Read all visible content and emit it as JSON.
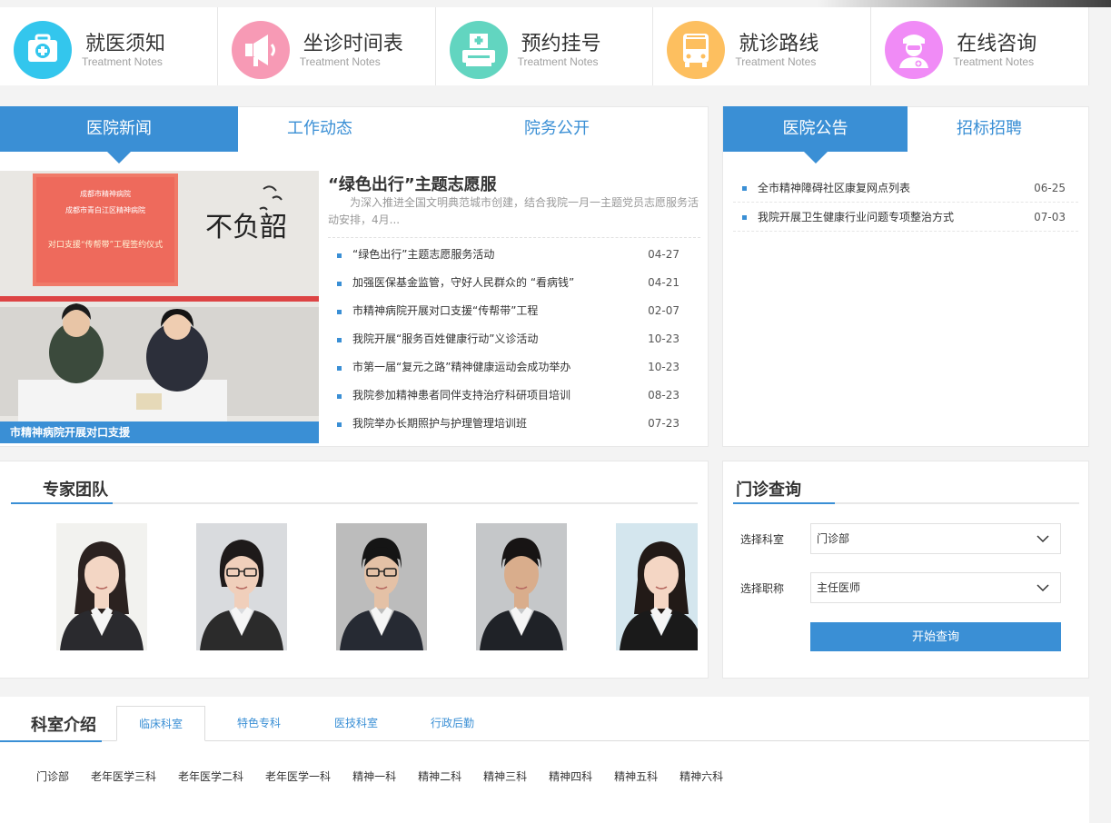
{
  "quicknav": [
    {
      "title": "就医须知",
      "sub": "Treatment Notes",
      "icon": "first-aid-kit-icon",
      "color": "#33c6ed"
    },
    {
      "title": "坐诊时间表",
      "sub": "Treatment Notes",
      "icon": "megaphone-icon",
      "color": "#f79ab5"
    },
    {
      "title": "预约挂号",
      "sub": "Treatment Notes",
      "icon": "register-printer-icon",
      "color": "#62d5c0"
    },
    {
      "title": "就诊路线",
      "sub": "Treatment Notes",
      "icon": "bus-icon",
      "color": "#fdbf5f"
    },
    {
      "title": "在线咨询",
      "sub": "Treatment Notes",
      "icon": "nurse-icon",
      "color": "#f08bf6"
    }
  ],
  "news": {
    "tabs": [
      "医院新闻",
      "工作动态",
      "院务公开"
    ],
    "feature": {
      "title": "“绿色出行”主题志愿服",
      "desc": "为深入推进全国文明典范城市创建，结合我院一月一主题党员志愿服务活动安排，4月...",
      "caption": "市精神病院开展对口支援",
      "banner_line1": "成都市精神病院",
      "banner_line2": "成都市青白江区精神病院",
      "banner_line3": "对口支援“传帮带”工程签约仪式",
      "wall_text": "不负韶"
    },
    "items": [
      {
        "title": "“绿色出行”主题志愿服务活动",
        "date": "04-27"
      },
      {
        "title": "加强医保基金监管，守好人民群众的 “看病钱”",
        "date": "04-21"
      },
      {
        "title": "市精神病院开展对口支援“传帮带”工程",
        "date": "02-07"
      },
      {
        "title": "我院开展“服务百姓健康行动”义诊活动",
        "date": "10-23"
      },
      {
        "title": "市第一届“复元之路”精神健康运动会成功举办",
        "date": "10-23"
      },
      {
        "title": "我院参加精神患者同伴支持治疗科研项目培训",
        "date": "08-23"
      },
      {
        "title": "我院举办长期照护与护理管理培训班",
        "date": "07-23"
      }
    ]
  },
  "notice": {
    "tabs": [
      "医院公告",
      "招标招聘"
    ],
    "items": [
      {
        "title": "全市精神障碍社区康复网点列表",
        "date": "06-25"
      },
      {
        "title": "我院开展卫生健康行业问题专项整治方式",
        "date": "07-03"
      }
    ]
  },
  "experts": {
    "title": "专家团队",
    "people": [
      {
        "bg": "#f2f2ef",
        "skin": "#f3d6c4",
        "hair": "#2b2220",
        "suit": "#2a2a2e",
        "glasses": false,
        "hair_style": "long"
      },
      {
        "bg": "#d9dbde",
        "skin": "#f0cfbb",
        "hair": "#1e1a1a",
        "suit": "#2b2b2b",
        "glasses": true,
        "hair_style": "bun"
      },
      {
        "bg": "#bcbcbc",
        "skin": "#e4c1a6",
        "hair": "#151515",
        "suit": "#262a33",
        "glasses": true,
        "hair_style": "short"
      },
      {
        "bg": "#c5c7c9",
        "skin": "#d9ad8c",
        "hair": "#171414",
        "suit": "#1f2227",
        "glasses": false,
        "hair_style": "short"
      },
      {
        "bg": "#d4e6ee",
        "skin": "#f4d6c4",
        "hair": "#221a17",
        "suit": "#1a1a1a",
        "glasses": false,
        "hair_style": "long"
      }
    ]
  },
  "clinic": {
    "title": "门诊查询",
    "dept_label": "选择科室",
    "dept_value": "门诊部",
    "title_label": "选择职称",
    "title_value": "主任医师",
    "button": "开始查询"
  },
  "departments": {
    "title": "科室介绍",
    "tabs": [
      "临床科室",
      "特色专科",
      "医技科室",
      "行政后勤"
    ],
    "items": [
      "门诊部",
      "老年医学三科",
      "老年医学二科",
      "老年医学一科",
      "精神一科",
      "精神二科",
      "精神三科",
      "精神四科",
      "精神五科",
      "精神六科"
    ]
  }
}
